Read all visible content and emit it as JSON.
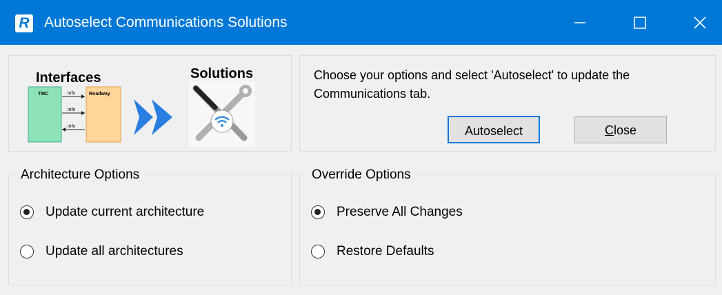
{
  "window": {
    "title": "Autoselect Communications Solutions",
    "app_icon_letter": "R",
    "controls": [
      "minimize-icon",
      "maximize-icon",
      "close-icon"
    ]
  },
  "header": {
    "interfaces_label": "Interfaces",
    "solutions_label": "Solutions",
    "diagram": {
      "left_box": "TMC",
      "right_box": "Roadway",
      "flow_labels": [
        "info",
        "info",
        "info"
      ]
    }
  },
  "instructions": "Choose your options and select 'Autoselect' to update the Communications tab.",
  "buttons": {
    "autoselect": "Autoselect",
    "close_mnemonic": "C",
    "close_rest": "lose"
  },
  "architecture_options": {
    "title": "Architecture Options",
    "options": [
      {
        "label": "Update current architecture",
        "selected": true
      },
      {
        "label": "Update all architectures",
        "selected": false
      }
    ]
  },
  "override_options": {
    "title": "Override Options",
    "options": [
      {
        "label": "Preserve All Changes",
        "selected": true
      },
      {
        "label": "Restore Defaults",
        "selected": false
      }
    ]
  },
  "colors": {
    "titlebar": "#0078d7",
    "accent_focus": "#0078d7",
    "window_bg": "#f0f0f0"
  }
}
